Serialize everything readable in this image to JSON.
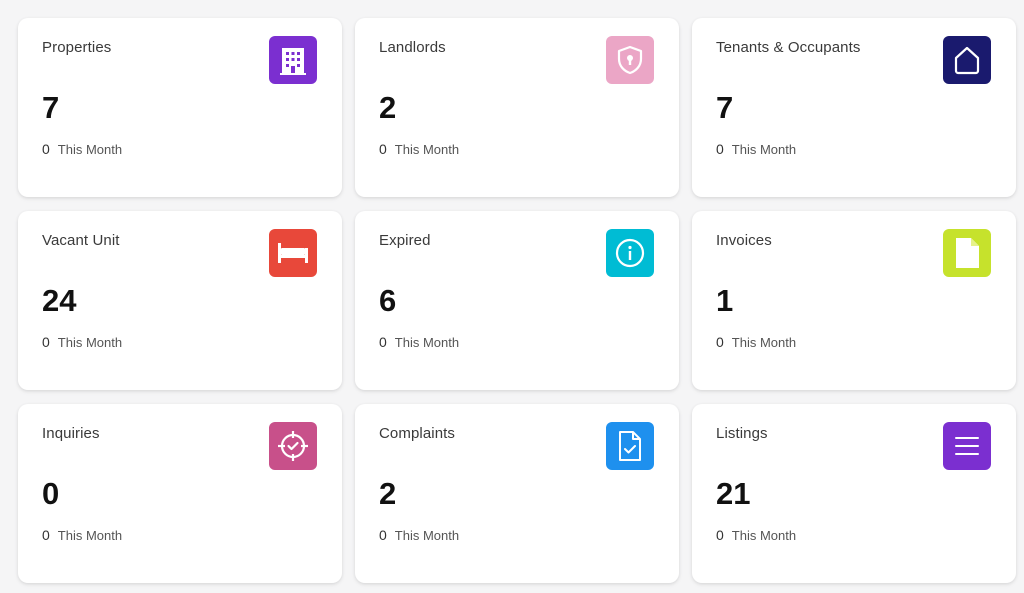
{
  "cards": [
    {
      "title": "Properties",
      "value": "7",
      "delta": "0",
      "period": "This Month",
      "icon": "building-icon",
      "color": "#7b2fd0"
    },
    {
      "title": "Landlords",
      "value": "2",
      "delta": "0",
      "period": "This Month",
      "icon": "shield-icon",
      "color": "#eba6c6"
    },
    {
      "title": "Tenants & Occupants",
      "value": "7",
      "delta": "0",
      "period": "This Month",
      "icon": "home-icon",
      "color": "#1a1a6e"
    },
    {
      "title": "Vacant Unit",
      "value": "24",
      "delta": "0",
      "period": "This Month",
      "icon": "bed-icon",
      "color": "#e8483a"
    },
    {
      "title": "Expired",
      "value": "6",
      "delta": "0",
      "period": "This Month",
      "icon": "info-icon",
      "color": "#00bcd4"
    },
    {
      "title": "Invoices",
      "value": "1",
      "delta": "0",
      "period": "This Month",
      "icon": "document-icon",
      "color": "#c6e22c"
    },
    {
      "title": "Inquiries",
      "value": "0",
      "delta": "0",
      "period": "This Month",
      "icon": "target-icon",
      "color": "#c8508a"
    },
    {
      "title": "Complaints",
      "value": "2",
      "delta": "0",
      "period": "This Month",
      "icon": "file-check-icon",
      "color": "#1e90ee"
    },
    {
      "title": "Listings",
      "value": "21",
      "delta": "0",
      "period": "This Month",
      "icon": "menu-icon",
      "color": "#7b2fd0"
    }
  ]
}
